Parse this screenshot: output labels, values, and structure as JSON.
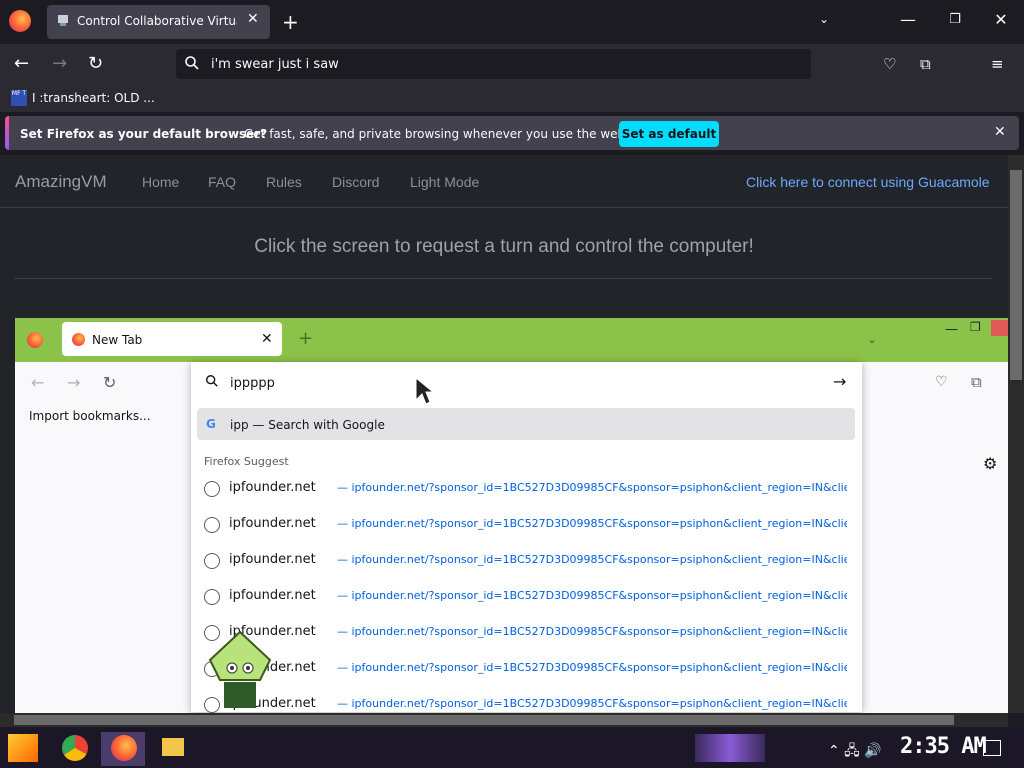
{
  "browser": {
    "tab_title": "Control Collaborative Virtual Machines!",
    "url_text": "i'm swear just i saw",
    "bookmark_label": "I :transheart: OLD ...",
    "bookmark_icon_text": "MF T",
    "notification": {
      "bold": "Set Firefox as your default browser?",
      "text": "Get fast, safe, and private browsing whenever you use the web.",
      "button": "Set as default"
    }
  },
  "site": {
    "brand": "AmazingVM",
    "nav": [
      "Home",
      "FAQ",
      "Rules",
      "Discord",
      "Light Mode"
    ],
    "guacamole_link": "Click here to connect using Guacamole",
    "headline": "Click the screen to request a turn and control the computer!"
  },
  "vm": {
    "tab_title": "New Tab",
    "url_input": "ippppp",
    "bookmark": "Import bookmarks...",
    "google_row": "ipp — Search with Google",
    "google_letter": "G",
    "suggest_label": "Firefox Suggest",
    "suggestions": [
      {
        "title": "ipfounder.net",
        "url": "—  ipfounder.net/?sponsor_id=1BC527D3D09985CF&sponsor=psiphon&client_region=IN&client_as"
      },
      {
        "title": "ipfounder.net",
        "url": "—  ipfounder.net/?sponsor_id=1BC527D3D09985CF&sponsor=psiphon&client_region=IN&client_as"
      },
      {
        "title": "ipfounder.net",
        "url": "—  ipfounder.net/?sponsor_id=1BC527D3D09985CF&sponsor=psiphon&client_region=IN&client_as"
      },
      {
        "title": "ipfounder.net",
        "url": "—  ipfounder.net/?sponsor_id=1BC527D3D09985CF&sponsor=psiphon&client_region=IN&client_as"
      },
      {
        "title": "ipfounder.net",
        "url": "—  ipfounder.net/?sponsor_id=1BC527D3D09985CF&sponsor=psiphon&client_region=IN&client_as"
      },
      {
        "title": "ipfounder.net",
        "url": "—  ipfounder.net/?sponsor_id=1BC527D3D09985CF&sponsor=psiphon&client_region=IN&client_as"
      },
      {
        "title": "ipfounder.net",
        "url": "—  ipfounder.net/?sponsor_id=1BC527D3D09985CF&sponsor=psiphon&client_region=IN&client_as"
      }
    ]
  },
  "taskbar": {
    "time": "2:35 AM"
  },
  "colors": {
    "vm_accent": "#8bc34a",
    "notif_button": "#00ddff",
    "link": "#6ea8fe"
  }
}
